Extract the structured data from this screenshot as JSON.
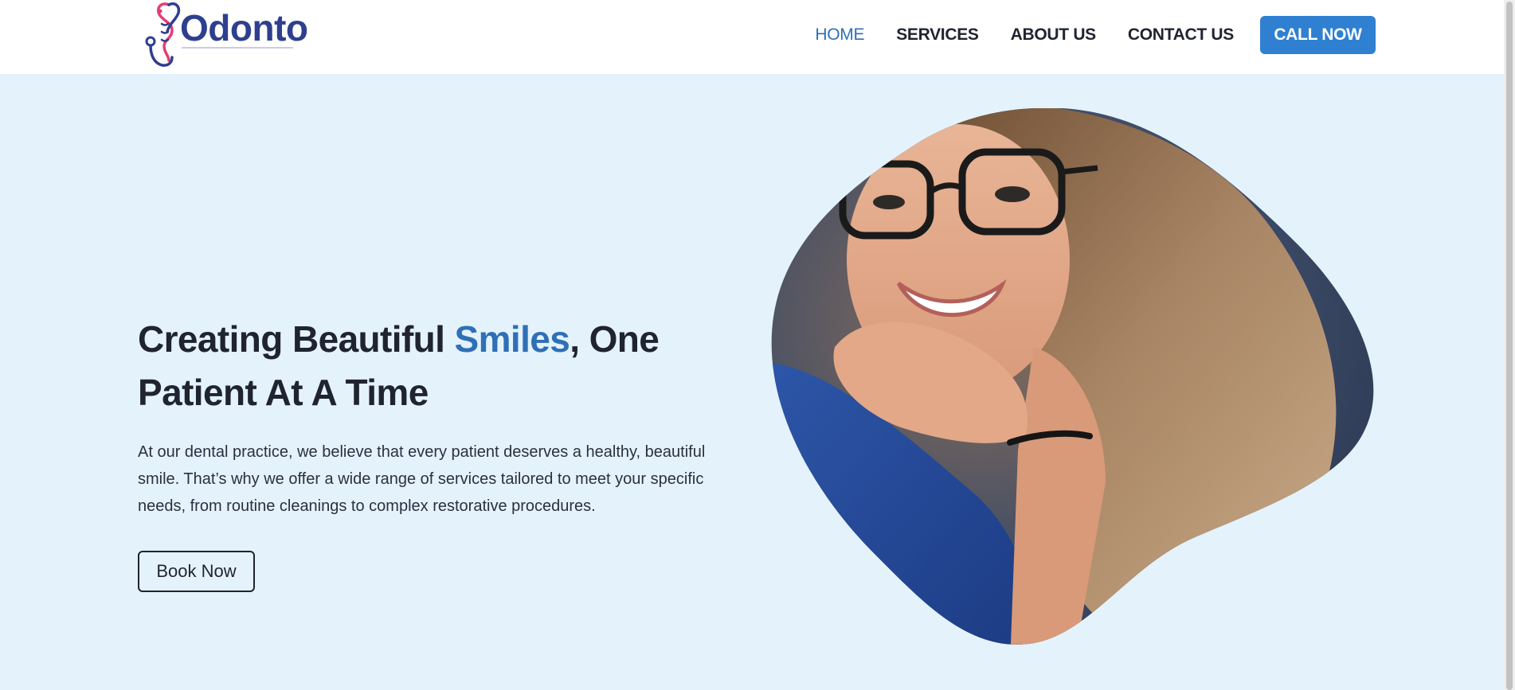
{
  "brand": {
    "name": "Odonto",
    "logo_icon": "stethoscope-tooth-icon"
  },
  "nav": {
    "items": [
      {
        "label": "HOME",
        "active": true
      },
      {
        "label": "SERVICES",
        "active": false
      },
      {
        "label": "ABOUT US",
        "active": false
      },
      {
        "label": "CONTACT US",
        "active": false
      }
    ],
    "cta_label": "CALL NOW"
  },
  "hero": {
    "title_part1": "Creating Beautiful ",
    "title_accent": "Smiles",
    "title_part2": ", One Patient At A Time",
    "description": "At our dental practice, we believe that every patient deserves a healthy, beautiful smile. That’s why we offer a wide range of services tailored to meet your specific needs, from routine cleanings to complex restorative procedures.",
    "button_label": "Book Now",
    "image": "smiling-woman-with-glasses-photo"
  },
  "colors": {
    "accent": "#2f6fb7",
    "cta_bg": "#2f80d1",
    "hero_bg": "#e4f2fc",
    "brand_text": "#2e3f8f",
    "brand_pink": "#e63b74"
  }
}
